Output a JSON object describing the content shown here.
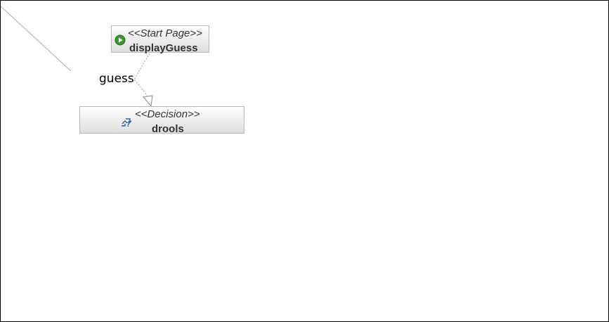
{
  "nodes": {
    "start": {
      "stereotype": "<<Start Page>>",
      "name": "displayGuess",
      "icon": "play-icon"
    },
    "decision": {
      "stereotype": "<<Decision>>",
      "name": "drools",
      "icon": "decision-icon"
    }
  },
  "edge": {
    "label": "guess"
  },
  "colors": {
    "node_border": "#b8b8b8",
    "start_icon": "#3a9a2a",
    "decision_icon": "#2a5db0",
    "connector": "#999999",
    "text": "#333333"
  }
}
